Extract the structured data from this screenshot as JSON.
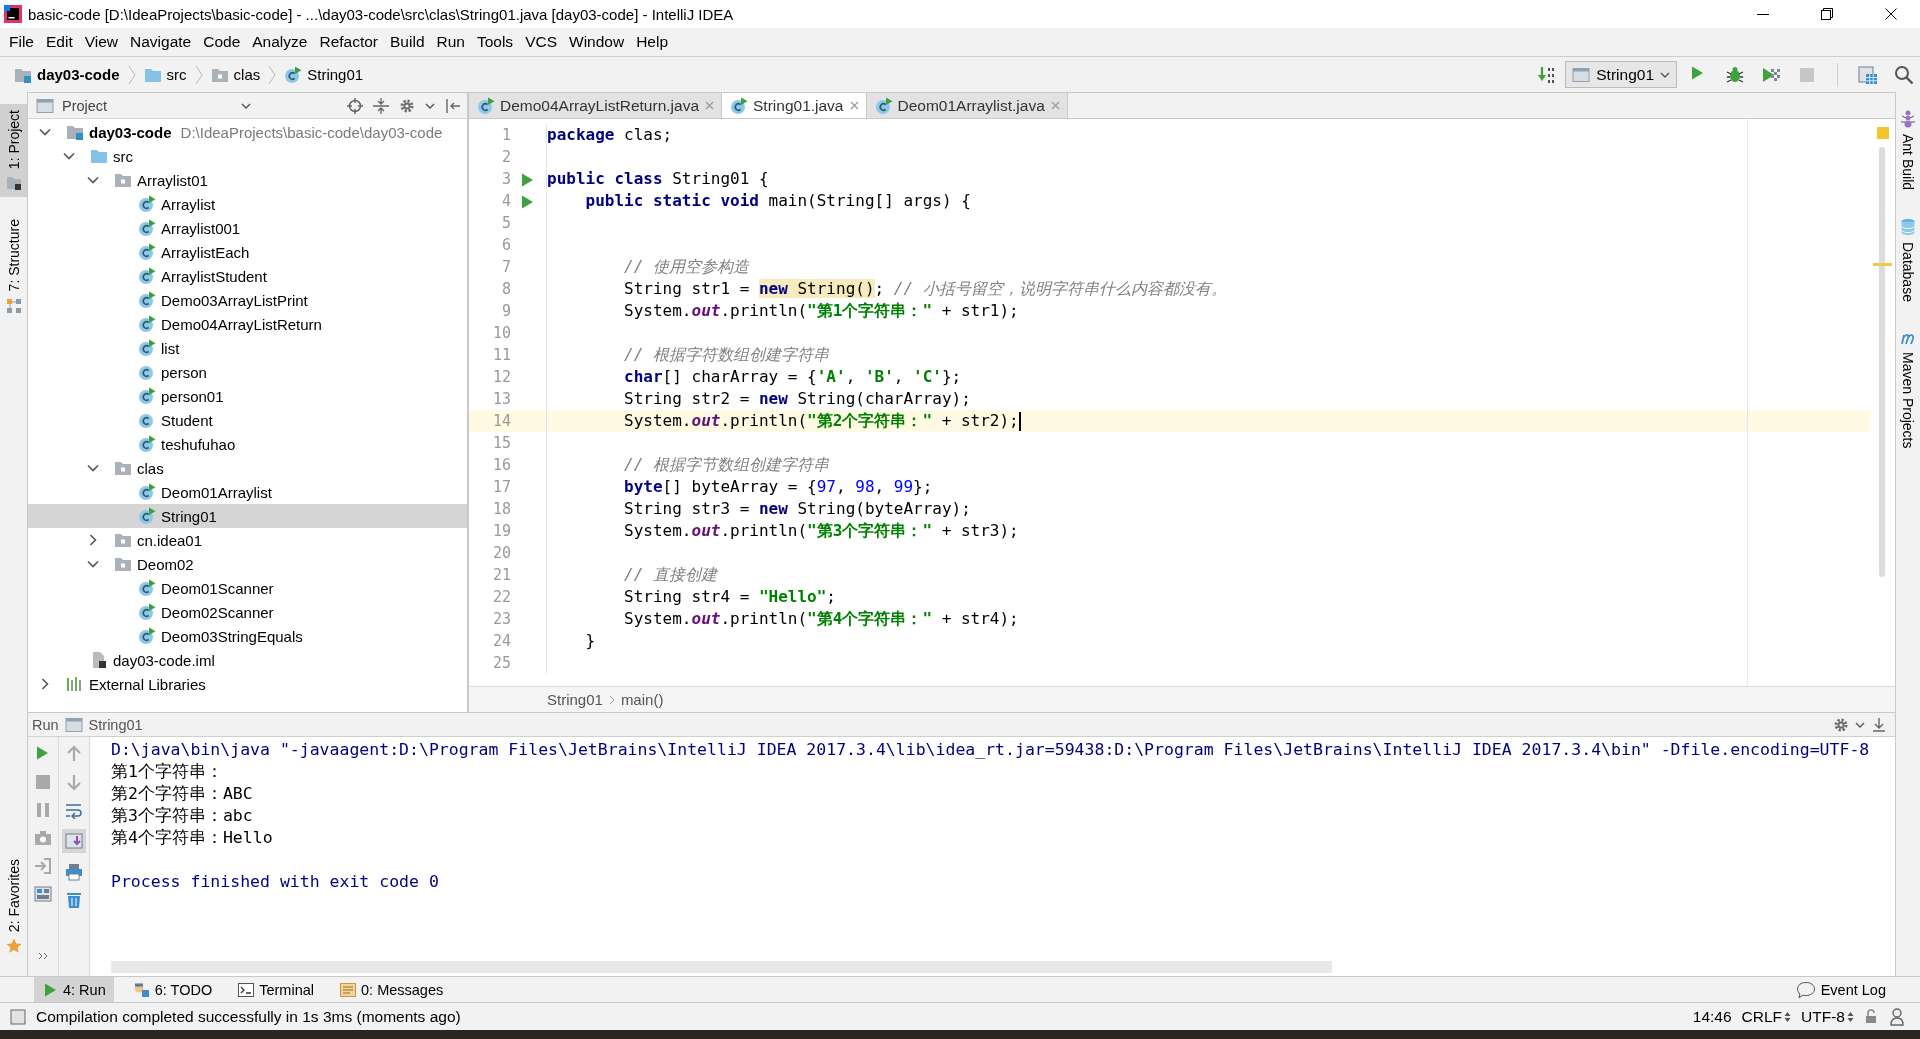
{
  "window": {
    "title": "basic-code [D:\\IdeaProjects\\basic-code] - ...\\day03-code\\src\\clas\\String01.java [day03-code] - IntelliJ IDEA"
  },
  "menu": [
    "File",
    "Edit",
    "View",
    "Navigate",
    "Code",
    "Analyze",
    "Refactor",
    "Build",
    "Run",
    "Tools",
    "VCS",
    "Window",
    "Help"
  ],
  "navbar": {
    "breadcrumbs": [
      {
        "label": "day03-code",
        "kind": "module"
      },
      {
        "label": "src",
        "kind": "source-folder"
      },
      {
        "label": "clas",
        "kind": "package"
      },
      {
        "label": "String01",
        "kind": "main-class"
      }
    ],
    "run_config": "String01"
  },
  "left_stripe": {
    "top": [
      {
        "label": "1: Project",
        "kind": "project",
        "selected": true
      },
      {
        "label": "7: Structure",
        "kind": "structure",
        "selected": false
      }
    ],
    "bottom": [
      {
        "label": "2: Favorites",
        "kind": "favorites",
        "selected": false
      }
    ]
  },
  "right_stripe": [
    {
      "label": "Ant Build",
      "kind": "ant"
    },
    {
      "label": "Database",
      "kind": "database"
    },
    {
      "label": "Maven Projects",
      "kind": "maven"
    }
  ],
  "project": {
    "title": "Project",
    "tree": [
      {
        "label": "day03-code",
        "path": "D:\\IdeaProjects\\basic-code\\day03-code",
        "kind": "module",
        "expanded": true,
        "selected": false,
        "children": [
          {
            "label": "src",
            "kind": "source-folder",
            "expanded": true,
            "selected": false,
            "children": [
              {
                "label": "Arraylist01",
                "kind": "package",
                "expanded": true,
                "selected": false,
                "children": [
                  {
                    "label": "Arraylist",
                    "kind": "main-class",
                    "selected": false
                  },
                  {
                    "label": "Arraylist001",
                    "kind": "main-class",
                    "selected": false
                  },
                  {
                    "label": "ArraylistEach",
                    "kind": "main-class",
                    "selected": false
                  },
                  {
                    "label": "ArraylistStudent",
                    "kind": "main-class",
                    "selected": false
                  },
                  {
                    "label": "Demo03ArrayListPrint",
                    "kind": "main-class",
                    "selected": false
                  },
                  {
                    "label": "Demo04ArrayListReturn",
                    "kind": "main-class",
                    "selected": false
                  },
                  {
                    "label": "list",
                    "kind": "main-class",
                    "selected": false
                  },
                  {
                    "label": "person",
                    "kind": "class",
                    "selected": false
                  },
                  {
                    "label": "person01",
                    "kind": "main-class",
                    "selected": false
                  },
                  {
                    "label": "Student",
                    "kind": "class",
                    "selected": false
                  },
                  {
                    "label": "teshufuhao",
                    "kind": "main-class",
                    "selected": false
                  }
                ]
              },
              {
                "label": "clas",
                "kind": "package",
                "expanded": true,
                "selected": false,
                "children": [
                  {
                    "label": "Deom01Arraylist",
                    "kind": "main-class",
                    "selected": false
                  },
                  {
                    "label": "String01",
                    "kind": "main-class",
                    "selected": true
                  }
                ]
              },
              {
                "label": "cn.idea01",
                "kind": "package",
                "expanded": false,
                "selected": false
              },
              {
                "label": "Deom02",
                "kind": "package",
                "expanded": true,
                "selected": false,
                "children": [
                  {
                    "label": "Deom01Scanner",
                    "kind": "main-class",
                    "selected": false
                  },
                  {
                    "label": "Deom02Scanner",
                    "kind": "main-class",
                    "selected": false
                  },
                  {
                    "label": "Deom03StringEquals",
                    "kind": "main-class",
                    "selected": false
                  }
                ]
              }
            ]
          },
          {
            "label": "day03-code.iml",
            "kind": "module-file",
            "selected": false
          }
        ]
      },
      {
        "label": "External Libraries",
        "kind": "libraries",
        "expanded": false,
        "selected": false
      }
    ]
  },
  "editor": {
    "tabs": [
      {
        "label": "Demo04ArrayListReturn.java",
        "selected": false
      },
      {
        "label": "String01.java",
        "selected": true
      },
      {
        "label": "Deom01Arraylist.java",
        "selected": false
      }
    ],
    "lines": [
      {
        "number": "1",
        "current": false,
        "run_marker": false,
        "tokens": [
          {
            "text": "package",
            "kind": "keyword"
          },
          {
            "text": " clas;",
            "kind": "plain"
          }
        ]
      },
      {
        "number": "2",
        "current": false,
        "run_marker": false
      },
      {
        "number": "3",
        "current": false,
        "run_marker": true,
        "tokens": [
          {
            "text": "public class",
            "kind": "keyword"
          },
          {
            "text": " String01 {",
            "kind": "plain"
          }
        ]
      },
      {
        "number": "4",
        "current": false,
        "run_marker": true,
        "tokens": [
          {
            "text": "    public static void",
            "kind": "keyword"
          },
          {
            "text": " main(String[] args) {",
            "kind": "plain"
          }
        ]
      },
      {
        "number": "5",
        "current": false,
        "run_marker": false
      },
      {
        "number": "6",
        "current": false,
        "run_marker": false
      },
      {
        "number": "7",
        "current": false,
        "run_marker": false,
        "tokens": [
          {
            "text": "        // 使用空参构造",
            "kind": "comment"
          }
        ]
      },
      {
        "number": "8",
        "current": false,
        "run_marker": false,
        "tokens": [
          {
            "text": "        String str1 = ",
            "kind": "plain"
          },
          {
            "text": "new",
            "kind": "keyword-usage"
          },
          {
            "text": " String()",
            "kind": "plain-usage"
          },
          {
            "text": "; ",
            "kind": "plain"
          },
          {
            "text": "// 小括号留空，说明字符串什么内容都没有。",
            "kind": "comment"
          }
        ]
      },
      {
        "number": "9",
        "current": false,
        "run_marker": false,
        "tokens": [
          {
            "text": "        System.",
            "kind": "plain"
          },
          {
            "text": "out",
            "kind": "field"
          },
          {
            "text": ".println(",
            "kind": "plain"
          },
          {
            "text": "\"第1个字符串：\"",
            "kind": "string"
          },
          {
            "text": " + str1);",
            "kind": "plain"
          }
        ]
      },
      {
        "number": "10",
        "current": false,
        "run_marker": false
      },
      {
        "number": "11",
        "current": false,
        "run_marker": false,
        "tokens": [
          {
            "text": "        // 根据字符数组创建字符串",
            "kind": "comment"
          }
        ]
      },
      {
        "number": "12",
        "current": false,
        "run_marker": false,
        "tokens": [
          {
            "text": "        char",
            "kind": "keyword"
          },
          {
            "text": "[] charArray = {",
            "kind": "plain"
          },
          {
            "text": "'A'",
            "kind": "string"
          },
          {
            "text": ", ",
            "kind": "plain"
          },
          {
            "text": "'B'",
            "kind": "string"
          },
          {
            "text": ", ",
            "kind": "plain"
          },
          {
            "text": "'C'",
            "kind": "string"
          },
          {
            "text": "};",
            "kind": "plain"
          }
        ]
      },
      {
        "number": "13",
        "current": false,
        "run_marker": false,
        "tokens": [
          {
            "text": "        String str2 = ",
            "kind": "plain"
          },
          {
            "text": "new",
            "kind": "keyword"
          },
          {
            "text": " String(charArray);",
            "kind": "plain"
          }
        ]
      },
      {
        "number": "14",
        "current": true,
        "run_marker": false,
        "tokens": [
          {
            "text": "        System.",
            "kind": "plain"
          },
          {
            "text": "out",
            "kind": "field"
          },
          {
            "text": ".println(",
            "kind": "plain"
          },
          {
            "text": "\"第2个字符串：\"",
            "kind": "string"
          },
          {
            "text": " + str2);",
            "kind": "plain"
          }
        ]
      },
      {
        "number": "15",
        "current": false,
        "run_marker": false
      },
      {
        "number": "16",
        "current": false,
        "run_marker": false,
        "tokens": [
          {
            "text": "        // 根据字节数组创建字符串",
            "kind": "comment"
          }
        ]
      },
      {
        "number": "17",
        "current": false,
        "run_marker": false,
        "tokens": [
          {
            "text": "        byte",
            "kind": "keyword"
          },
          {
            "text": "[] byteArray = {",
            "kind": "plain"
          },
          {
            "text": "97",
            "kind": "number"
          },
          {
            "text": ", ",
            "kind": "plain"
          },
          {
            "text": "98",
            "kind": "number"
          },
          {
            "text": ", ",
            "kind": "plain"
          },
          {
            "text": "99",
            "kind": "number"
          },
          {
            "text": "};",
            "kind": "plain"
          }
        ]
      },
      {
        "number": "18",
        "current": false,
        "run_marker": false,
        "tokens": [
          {
            "text": "        String str3 = ",
            "kind": "plain"
          },
          {
            "text": "new",
            "kind": "keyword"
          },
          {
            "text": " String(byteArray);",
            "kind": "plain"
          }
        ]
      },
      {
        "number": "19",
        "current": false,
        "run_marker": false,
        "tokens": [
          {
            "text": "        System.",
            "kind": "plain"
          },
          {
            "text": "out",
            "kind": "field"
          },
          {
            "text": ".println(",
            "kind": "plain"
          },
          {
            "text": "\"第3个字符串：\"",
            "kind": "string"
          },
          {
            "text": " + str3);",
            "kind": "plain"
          }
        ]
      },
      {
        "number": "20",
        "current": false,
        "run_marker": false
      },
      {
        "number": "21",
        "current": false,
        "run_marker": false,
        "tokens": [
          {
            "text": "        // 直接创建",
            "kind": "comment"
          }
        ]
      },
      {
        "number": "22",
        "current": false,
        "run_marker": false,
        "tokens": [
          {
            "text": "        String str4 = ",
            "kind": "plain"
          },
          {
            "text": "\"Hello\"",
            "kind": "string"
          },
          {
            "text": ";",
            "kind": "plain"
          }
        ]
      },
      {
        "number": "23",
        "current": false,
        "run_marker": false,
        "tokens": [
          {
            "text": "        System.",
            "kind": "plain"
          },
          {
            "text": "out",
            "kind": "field"
          },
          {
            "text": ".println(",
            "kind": "plain"
          },
          {
            "text": "\"第4个字符串：\"",
            "kind": "string"
          },
          {
            "text": " + str4);",
            "kind": "plain"
          }
        ]
      },
      {
        "number": "24",
        "current": false,
        "run_marker": false,
        "tokens": [
          {
            "text": "    }",
            "kind": "plain"
          }
        ]
      },
      {
        "number": "25",
        "current": false,
        "run_marker": false
      }
    ],
    "breadcrumbs": [
      "String01",
      "main()"
    ]
  },
  "run_panel": {
    "title": "Run",
    "config": "String01",
    "output": [
      {
        "text": "D:\\java\\bin\\java \"-javaagent:D:\\Program Files\\JetBrains\\IntelliJ IDEA 2017.3.4\\lib\\idea_rt.jar=59438:D:\\Program Files\\JetBrains\\IntelliJ IDEA 2017.3.4\\bin\" -Dfile.encoding=UTF-8",
        "kind": "command"
      },
      {
        "text": "第1个字符串：",
        "kind": "stdout"
      },
      {
        "text": "第2个字符串：ABC",
        "kind": "stdout"
      },
      {
        "text": "第3个字符串：abc",
        "kind": "stdout"
      },
      {
        "text": "第4个字符串：Hello",
        "kind": "stdout"
      },
      {
        "text": "Process finished with exit code 0",
        "kind": "exit"
      }
    ]
  },
  "bottom_tabs": [
    {
      "label": "4: Run",
      "kind": "run",
      "selected": true
    },
    {
      "label": "6: TODO",
      "kind": "todo",
      "selected": false
    },
    {
      "label": "Terminal",
      "kind": "terminal",
      "selected": false
    },
    {
      "label": "0: Messages",
      "kind": "messages",
      "selected": false
    }
  ],
  "event_log": "Event Log",
  "status_bar": {
    "message": "Compilation completed successfully in 1s 3ms (moments ago)",
    "position": "14:46",
    "line_separator": "CRLF",
    "encoding": "UTF-8"
  }
}
